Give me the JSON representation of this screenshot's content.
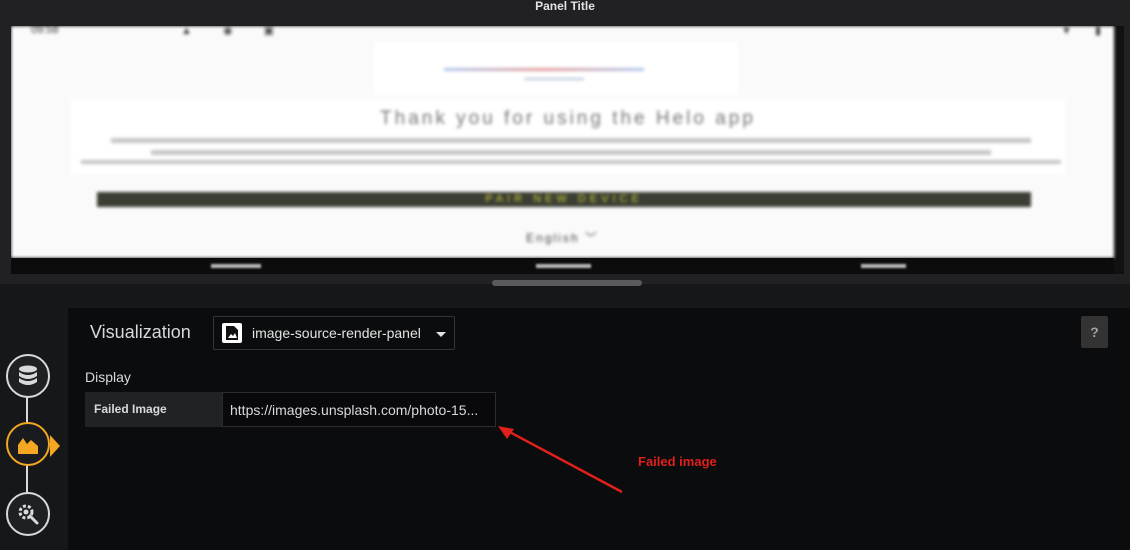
{
  "panel": {
    "title": "Panel Title"
  },
  "rendered_image": {
    "status_time": "09:58",
    "welcome_text": "Thank you for using the Helo app",
    "pair_button": "PAIR NEW DEVICE",
    "language": "English ﹀"
  },
  "editor": {
    "visualization_label": "Visualization",
    "plugin_name": "image-source-render-panel",
    "help_label": "?",
    "display_section": "Display",
    "field_label": "Failed Image",
    "field_value": "https://images.unsplash.com/photo-15..."
  },
  "sidebar": {
    "items": [
      {
        "icon": "database-icon"
      },
      {
        "icon": "visualization-icon",
        "active": true
      },
      {
        "icon": "settings-icon"
      }
    ]
  },
  "annotation": {
    "text": "Failed image",
    "color": "#e0201b"
  },
  "colors": {
    "active_accent": "#f5a623",
    "background": "#161719"
  }
}
